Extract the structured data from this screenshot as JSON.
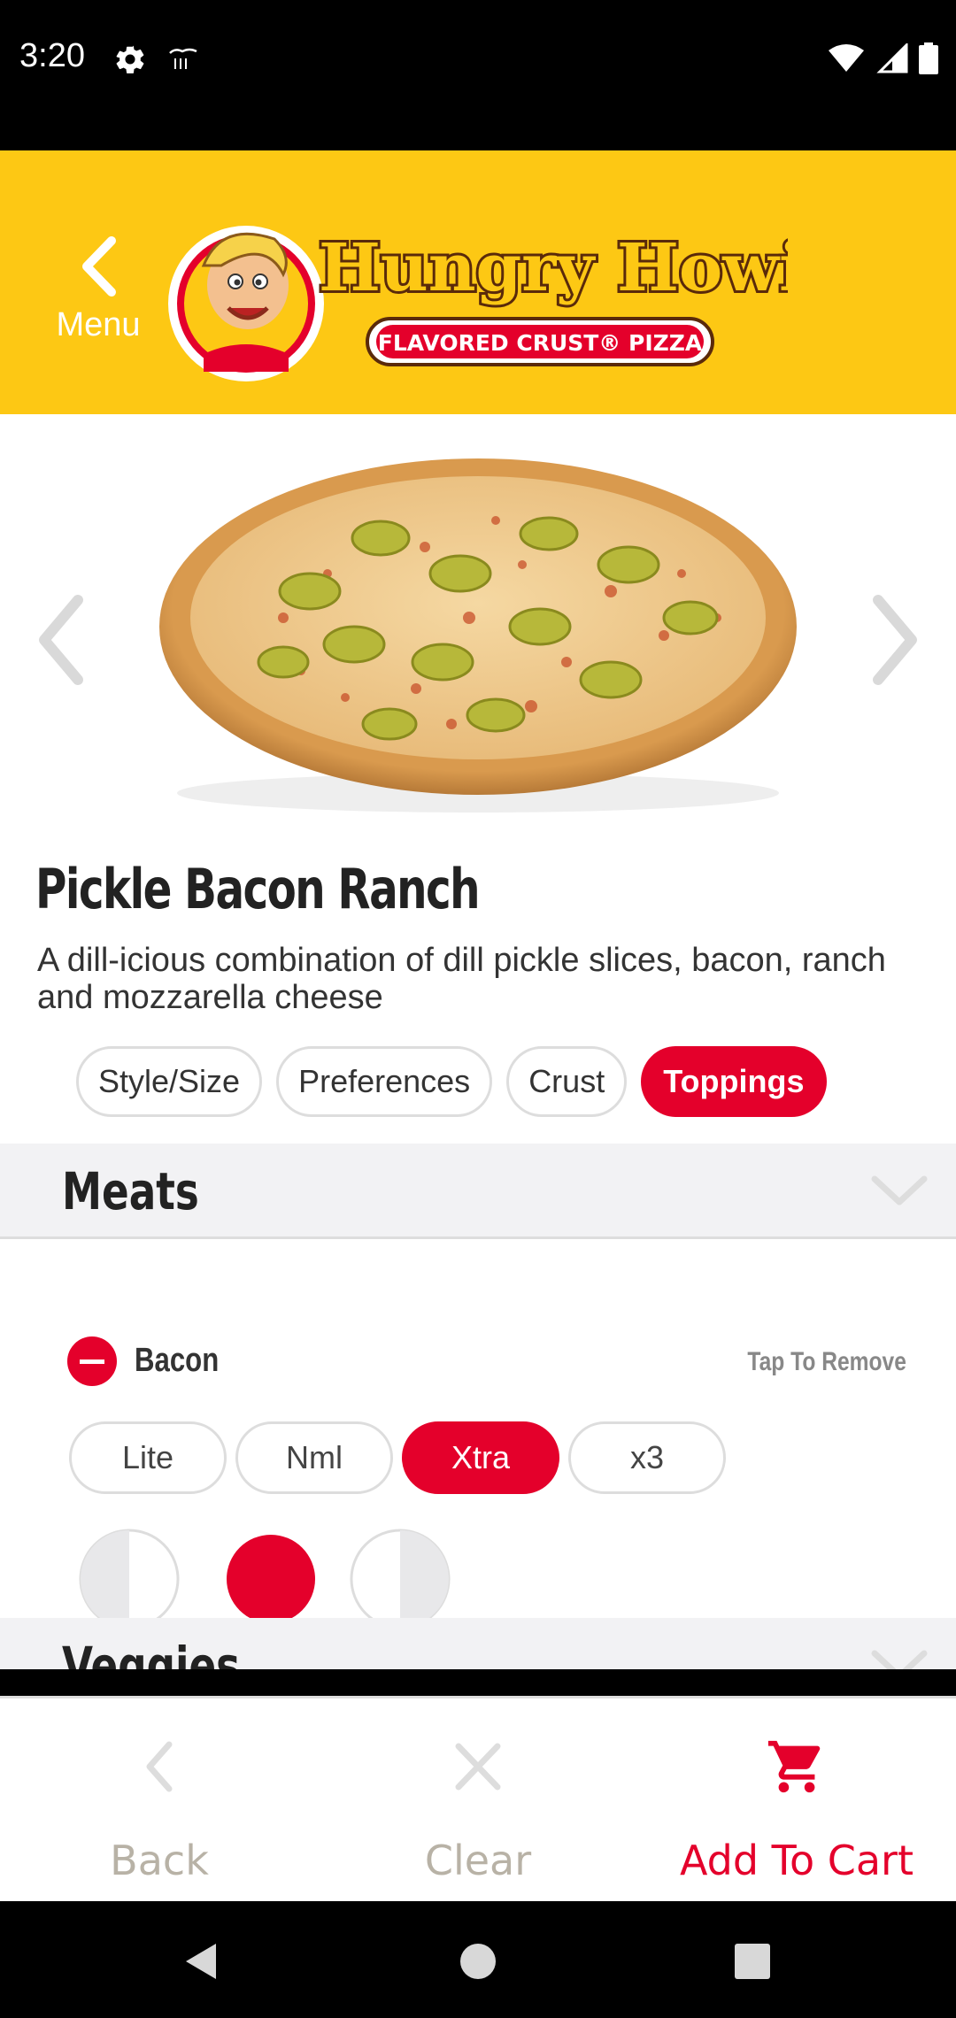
{
  "status_bar": {
    "time": "3:20"
  },
  "header": {
    "back_label": "Menu",
    "logo_text": "Hungry Howie's",
    "logo_tagline": "FLAVORED CRUST® PIZZA"
  },
  "product": {
    "title": "Pickle Bacon Ranch",
    "description": "A dill-icious combination of dill pickle slices, bacon, ranch and mozzarella cheese"
  },
  "tabs": [
    {
      "label": "Style/Size",
      "active": false
    },
    {
      "label": "Preferences",
      "active": false
    },
    {
      "label": "Crust",
      "active": false
    },
    {
      "label": "Toppings",
      "active": true
    }
  ],
  "sections": {
    "meats": "Meats",
    "veggies": "Veggies"
  },
  "topping": {
    "name": "Bacon",
    "action_hint": "Tap To Remove",
    "amounts": [
      {
        "label": "Lite",
        "active": false
      },
      {
        "label": "Nml",
        "active": false
      },
      {
        "label": "Xtra",
        "active": true
      },
      {
        "label": "x3",
        "active": false
      }
    ],
    "placement_selected": "whole"
  },
  "footer": {
    "back": "Back",
    "clear": "Clear",
    "add_to_cart": "Add To Cart"
  },
  "colors": {
    "brand_yellow": "#fdc814",
    "accent_red": "#e4002b",
    "muted": "#b8b2a6"
  }
}
